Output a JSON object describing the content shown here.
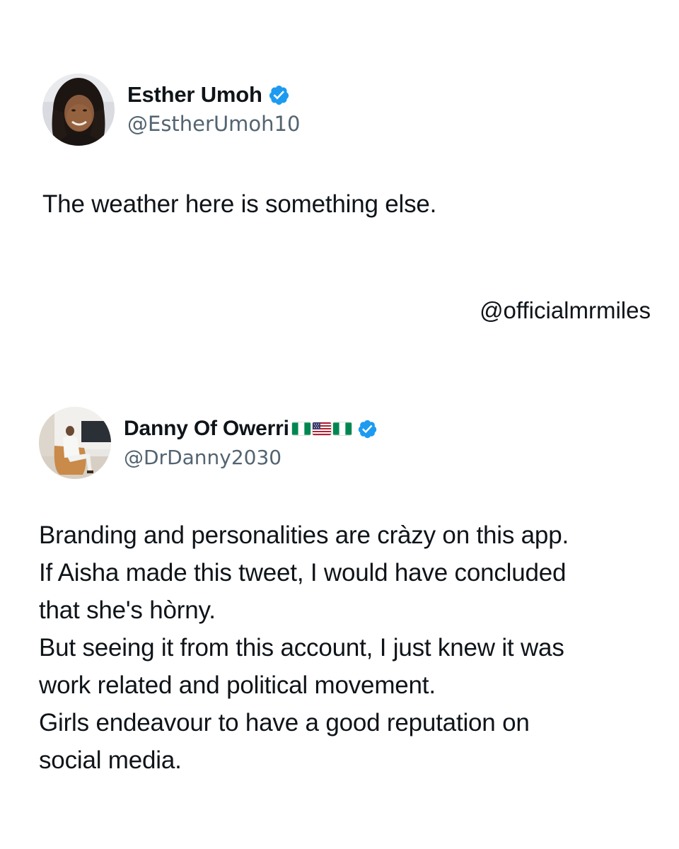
{
  "tweets": [
    {
      "author": {
        "display_name": "Esther Umoh",
        "handle": "@EstherUmoh10",
        "verified": true,
        "avatar_icon": "profile-photo-woman-braids"
      },
      "text_lines": [
        "The weather here is something else."
      ]
    },
    {
      "author": {
        "display_name": "Danny Of Owerri",
        "name_flags": [
          "nigeria-flag",
          "usa-flag",
          "nigeria-flag"
        ],
        "handle": "@DrDanny2030",
        "verified": true,
        "avatar_icon": "profile-photo-man-seated"
      },
      "text_lines": [
        "Branding and personalities are cràzy on this app.",
        "If Aisha made this tweet, I would have concluded",
        "that she's hòrny.",
        "But seeing it from this account, I just knew it was",
        "work related and political movement.",
        "Girls endeavour to have a good reputation on",
        "social media."
      ]
    }
  ],
  "watermark": "@officialmrmiles",
  "colors": {
    "verified_blue": "#1d9bf0",
    "text": "#0f1419",
    "secondary_text": "#536471",
    "background": "#ffffff"
  }
}
